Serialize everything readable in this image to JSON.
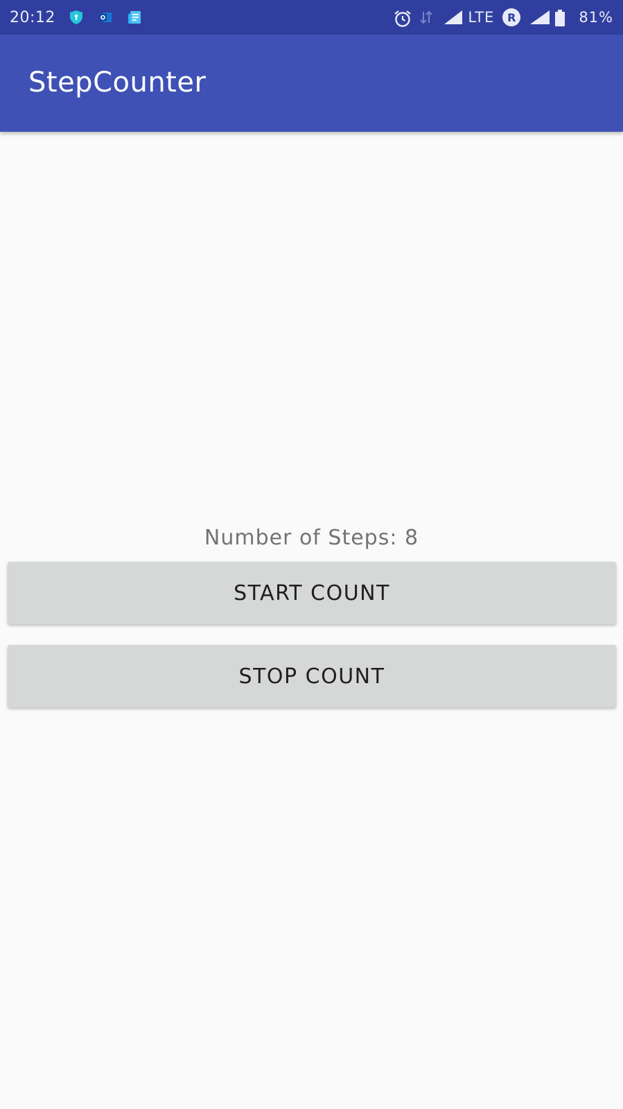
{
  "status_bar": {
    "time": "20:12",
    "network": "LTE",
    "roaming_badge": "R",
    "battery": "81%",
    "icons": [
      "shield-icon",
      "outlook-icon",
      "news-icon",
      "alarm-icon",
      "data-transfer-icon",
      "signal-icon",
      "roaming-icon",
      "signal-icon",
      "battery-icon"
    ]
  },
  "app_bar": {
    "title": "StepCounter"
  },
  "main": {
    "steps_text": "Number of Steps: 8",
    "start_button": "START COUNT",
    "stop_button": "STOP COUNT"
  },
  "colors": {
    "status_bar": "#303f9f",
    "app_bar": "#3f51b5",
    "button": "#d6d7d7",
    "background": "#fafafa"
  }
}
